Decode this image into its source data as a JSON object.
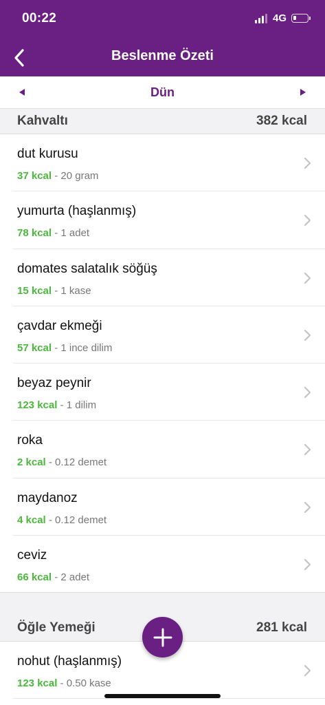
{
  "status_bar": {
    "time": "00:22",
    "network": "4G"
  },
  "header": {
    "title": "Beslenme Özeti"
  },
  "date_nav": {
    "label": "Dün"
  },
  "breakfast": {
    "title": "Kahvaltı",
    "total": "382 kcal",
    "items": [
      {
        "name": "dut kurusu",
        "kcal": "37 kcal",
        "portion": " - 20 gram"
      },
      {
        "name": "yumurta (haşlanmış)",
        "kcal": "78 kcal",
        "portion": " - 1 adet"
      },
      {
        "name": "domates salatalık söğüş",
        "kcal": "15 kcal",
        "portion": " - 1 kase"
      },
      {
        "name": "çavdar ekmeği",
        "kcal": "57 kcal",
        "portion": " - 1 ince dilim"
      },
      {
        "name": "beyaz peynir",
        "kcal": "123 kcal",
        "portion": " - 1 dilim"
      },
      {
        "name": "roka",
        "kcal": "2 kcal",
        "portion": " - 0.12 demet"
      },
      {
        "name": "maydanoz",
        "kcal": "4 kcal",
        "portion": " - 0.12 demet"
      },
      {
        "name": "ceviz",
        "kcal": "66 kcal",
        "portion": " - 2 adet"
      }
    ]
  },
  "lunch": {
    "title": "Öğle Yemeği",
    "total": "281 kcal",
    "items": [
      {
        "name": "nohut (haşlanmış)",
        "kcal": "123 kcal",
        "portion": " - 0.50 kase"
      }
    ]
  },
  "icons": {
    "back": "chevron-left-icon",
    "prev": "triangle-left-icon",
    "next": "triangle-right-icon",
    "row": "chevron-right-icon",
    "fab": "plus-icon"
  },
  "colors": {
    "brand": "#6a1f82",
    "kcal_green": "#4bb83d",
    "section_bg": "#f2f2f4"
  }
}
